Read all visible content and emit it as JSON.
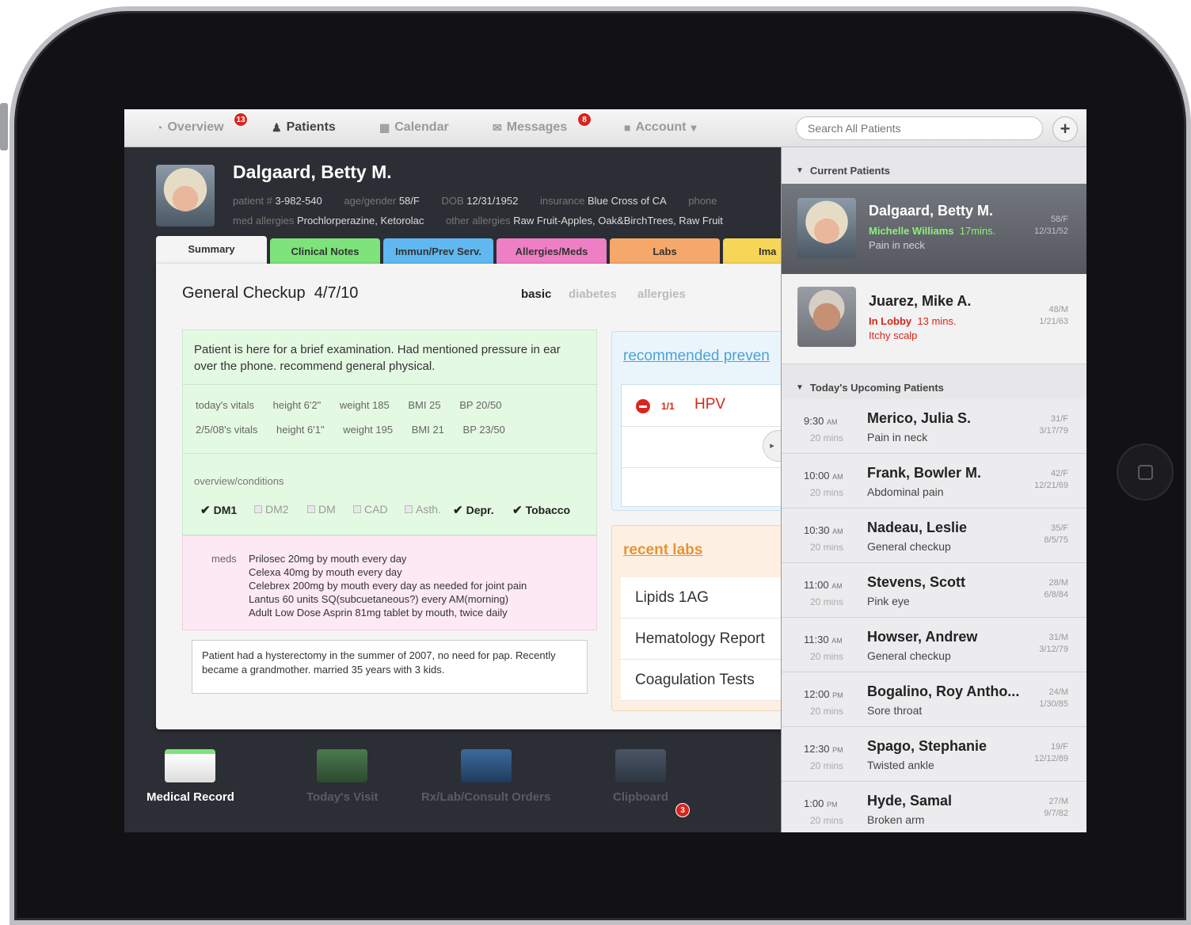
{
  "nav": {
    "overview": "Overview",
    "overview_badge": "13",
    "patients": "Patients",
    "calendar": "Calendar",
    "messages": "Messages",
    "messages_badge": "8",
    "account": "Account",
    "search_placeholder": "Search All Patients",
    "add": "+"
  },
  "patient": {
    "name": "Dalgaard, Betty M.",
    "row1": [
      {
        "label": "patient #",
        "value": "3-982-540"
      },
      {
        "label": "age/gender",
        "value": "58/F"
      },
      {
        "label": "DOB",
        "value": "12/31/1952"
      },
      {
        "label": "insurance",
        "value": "Blue Cross of CA"
      },
      {
        "label": "phone",
        "value": ""
      }
    ],
    "row2": [
      {
        "label": "med allergies",
        "value": "Prochlorperazine, Ketorolac"
      },
      {
        "label": "other allergies",
        "value": "Raw Fruit-Apples, Oak&BirchTrees, Raw Fruit"
      }
    ]
  },
  "tabs": [
    {
      "label": "Summary",
      "color": "#f4f4f4"
    },
    {
      "label": "Clinical Notes",
      "color": "#7ee37a"
    },
    {
      "label": "Immun/Prev Serv.",
      "color": "#5fb8ef"
    },
    {
      "label": "Allergies/Meds",
      "color": "#ef7fc4"
    },
    {
      "label": "Labs",
      "color": "#f5a86a"
    },
    {
      "label": "Ima",
      "color": "#f7d657"
    }
  ],
  "checkup": {
    "title": "General Checkup",
    "date": "4/7/10",
    "views": [
      "basic",
      "diabetes",
      "allergies"
    ]
  },
  "summary": {
    "note": "Patient is here for a brief examination. Had mentioned pressure in ear over the phone. recommend general physical.",
    "vitals": [
      [
        "today's vitals",
        "height  6'2\"",
        "weight  185",
        "BMI  25",
        "BP  20/50"
      ],
      [
        "2/5/08's vitals",
        "height  6'1\"",
        "weight  195",
        "BMI  21",
        "BP  23/50"
      ]
    ],
    "conditions_title": "overview/conditions",
    "conditions": [
      {
        "label": "DM1",
        "checked": true
      },
      {
        "label": "DM2",
        "checked": false
      },
      {
        "label": "DM",
        "checked": false
      },
      {
        "label": "CAD",
        "checked": false
      },
      {
        "label": "Asth.",
        "checked": false
      },
      {
        "label": "Depr.",
        "checked": true
      },
      {
        "label": "Tobacco",
        "checked": true
      }
    ],
    "meds_label": "meds",
    "meds": [
      "Prilosec 20mg by mouth every day",
      "Celexa 40mg by mouth every day",
      "Celebrex 200mg by mouth every day as needed for joint pain",
      "Lantus 60 units SQ(subcuetaneous?) every AM(morning)",
      "Adult Low Dose Asprin 81mg tablet by mouth, twice daily"
    ],
    "history": "Patient had a hysterectomy in the summer of 2007, no need for pap. Recently became a grandmother. married 35 years with 3 kids."
  },
  "preventive": {
    "title": "recommended preven",
    "items": [
      {
        "fraction": "1/1",
        "name": "HPV"
      }
    ]
  },
  "labs": {
    "title": "recent labs",
    "items": [
      "Lipids 1AG",
      "Hematology Report",
      "Coagulation Tests"
    ]
  },
  "dock": [
    {
      "label": "Medical Record",
      "active": true
    },
    {
      "label": "Today's Visit",
      "active": false
    },
    {
      "label": "Rx/Lab/Consult Orders",
      "active": false
    },
    {
      "label": "Clipboard",
      "active": false,
      "badge": "3"
    }
  ],
  "current_patients": {
    "title": "Current Patients",
    "items": [
      {
        "name": "Dalgaard, Betty M.",
        "doctor": "Michelle Williams",
        "wait": "17mins.",
        "reason": "Pain in neck",
        "age": "58/F",
        "dob": "12/31/52",
        "selected": true
      },
      {
        "name": "Juarez, Mike A.",
        "doctor": "In Lobby",
        "wait": "13 mins.",
        "reason": "Itchy scalp",
        "age": "48/M",
        "dob": "1/21/63",
        "selected": false
      }
    ]
  },
  "upcoming": {
    "title": "Today's Upcoming Patients",
    "items": [
      {
        "time": "9:30",
        "ampm": "AM",
        "duration": "20 mins",
        "name": "Merico, Julia S.",
        "reason": "Pain in neck",
        "age": "31/F",
        "dob": "3/17/79"
      },
      {
        "time": "10:00",
        "ampm": "AM",
        "duration": "20 mins",
        "name": "Frank, Bowler M.",
        "reason": "Abdominal pain",
        "age": "42/F",
        "dob": "12/21/69"
      },
      {
        "time": "10:30",
        "ampm": "AM",
        "duration": "20 mins",
        "name": "Nadeau, Leslie",
        "reason": "General checkup",
        "age": "35/F",
        "dob": "8/5/75"
      },
      {
        "time": "11:00",
        "ampm": "AM",
        "duration": "20 mins",
        "name": "Stevens, Scott",
        "reason": "Pink eye",
        "age": "28/M",
        "dob": "6/8/84"
      },
      {
        "time": "11:30",
        "ampm": "AM",
        "duration": "20 mins",
        "name": "Howser, Andrew",
        "reason": "General checkup",
        "age": "31/M",
        "dob": "3/12/79"
      },
      {
        "time": "12:00",
        "ampm": "PM",
        "duration": "20 mins",
        "name": "Bogalino, Roy Antho...",
        "reason": "Sore throat",
        "age": "24/M",
        "dob": "1/30/85"
      },
      {
        "time": "12:30",
        "ampm": "PM",
        "duration": "20 mins",
        "name": "Spago, Stephanie",
        "reason": "Twisted ankle",
        "age": "19/F",
        "dob": "12/12/89"
      },
      {
        "time": "1:00",
        "ampm": "PM",
        "duration": "20 mins",
        "name": "Hyde, Samal",
        "reason": "Broken arm",
        "age": "27/M",
        "dob": "9/7/82"
      }
    ]
  }
}
